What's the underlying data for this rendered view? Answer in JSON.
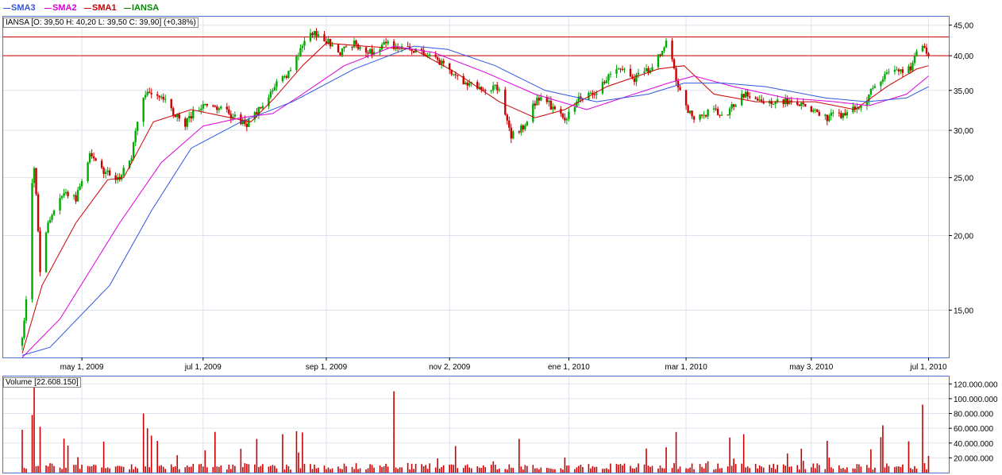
{
  "legend": [
    {
      "label": "SMA3",
      "color": "#3355dd"
    },
    {
      "label": "SMA2",
      "color": "#dd00dd"
    },
    {
      "label": "SMA1",
      "color": "#cc0000"
    },
    {
      "label": "IANSA",
      "color": "#008800"
    }
  ],
  "price_tag": "IANSA [O: 39,50  H: 40,20  L: 39,50  C: 39,90] (+0,38%)",
  "volume_tag": "Volume [22.608.150]",
  "chart_data": [
    {
      "type": "candlestick",
      "ticker": "IANSA",
      "y_scale": "log",
      "ylim": [
        12.5,
        46.5
      ],
      "yticks": [
        {
          "value": 45,
          "label": "45,00"
        },
        {
          "value": 40,
          "label": "40,00"
        },
        {
          "value": 35,
          "label": "35,00"
        },
        {
          "value": 30,
          "label": "30,00"
        },
        {
          "value": 25,
          "label": "25,00"
        },
        {
          "value": 20,
          "label": "20,00"
        },
        {
          "value": 15,
          "label": "15,00"
        }
      ],
      "xlim": [
        "2009-04-01",
        "2010-07-08"
      ],
      "xticks": [
        {
          "date": "2009-05-01",
          "label": "may 1, 2009"
        },
        {
          "date": "2009-07-01",
          "label": "jul 1, 2009"
        },
        {
          "date": "2009-09-01",
          "label": "sep 1, 2009"
        },
        {
          "date": "2009-11-02",
          "label": "nov 2, 2009"
        },
        {
          "date": "2010-01-01",
          "label": "ene 1, 2010"
        },
        {
          "date": "2010-03-01",
          "label": "mar 1, 2010"
        },
        {
          "date": "2010-05-03",
          "label": "may 3, 2010"
        },
        {
          "date": "2010-07-01",
          "label": "jul 1, 2010"
        }
      ],
      "horizontal_lines": [
        43.0,
        40.0
      ],
      "close_keypoints": [
        [
          "2009-04-01",
          13.5
        ],
        [
          "2009-04-03",
          15.5
        ],
        [
          "2009-04-06",
          24.5
        ],
        [
          "2009-04-07",
          26.0
        ],
        [
          "2009-04-10",
          17.5
        ],
        [
          "2009-04-14",
          21.0
        ],
        [
          "2009-04-21",
          23.5
        ],
        [
          "2009-04-28",
          23.0
        ],
        [
          "2009-05-05",
          27.5
        ],
        [
          "2009-05-12",
          25.5
        ],
        [
          "2009-05-20",
          25.0
        ],
        [
          "2009-05-26",
          27.0
        ],
        [
          "2009-05-31",
          34.0
        ],
        [
          "2009-06-03",
          35.0
        ],
        [
          "2009-06-14",
          33.0
        ],
        [
          "2009-06-21",
          30.5
        ],
        [
          "2009-06-28",
          32.5
        ],
        [
          "2009-07-05",
          33.0
        ],
        [
          "2009-07-14",
          32.0
        ],
        [
          "2009-07-23",
          30.5
        ],
        [
          "2009-07-30",
          33.0
        ],
        [
          "2009-08-06",
          35.5
        ],
        [
          "2009-08-14",
          37.5
        ],
        [
          "2009-08-19",
          41.5
        ],
        [
          "2009-08-25",
          43.5
        ],
        [
          "2009-09-01",
          42.5
        ],
        [
          "2009-09-08",
          40.5
        ],
        [
          "2009-09-15",
          42.0
        ],
        [
          "2009-09-24",
          40.5
        ],
        [
          "2009-09-30",
          42.0
        ],
        [
          "2009-10-10",
          41.0
        ],
        [
          "2009-10-20",
          40.5
        ],
        [
          "2009-10-30",
          38.5
        ],
        [
          "2009-11-08",
          36.5
        ],
        [
          "2009-11-18",
          35.0
        ],
        [
          "2009-11-27",
          35.5
        ],
        [
          "2009-11-30",
          31.5
        ],
        [
          "2009-12-03",
          29.5
        ],
        [
          "2009-12-10",
          30.5
        ],
        [
          "2009-12-16",
          34.0
        ],
        [
          "2009-12-23",
          33.0
        ],
        [
          "2009-12-30",
          31.0
        ],
        [
          "2010-01-06",
          34.0
        ],
        [
          "2010-01-15",
          35.0
        ],
        [
          "2010-01-27",
          38.5
        ],
        [
          "2010-02-02",
          36.5
        ],
        [
          "2010-02-10",
          38.0
        ],
        [
          "2010-02-17",
          40.5
        ],
        [
          "2010-02-20",
          43.0
        ],
        [
          "2010-02-24",
          36.5
        ],
        [
          "2010-02-28",
          33.5
        ],
        [
          "2010-03-05",
          31.0
        ],
        [
          "2010-03-14",
          32.5
        ],
        [
          "2010-03-21",
          32.0
        ],
        [
          "2010-03-30",
          34.5
        ],
        [
          "2010-04-08",
          33.5
        ],
        [
          "2010-04-20",
          33.5
        ],
        [
          "2010-04-30",
          33.0
        ],
        [
          "2010-05-10",
          31.5
        ],
        [
          "2010-05-20",
          32.0
        ],
        [
          "2010-05-29",
          33.0
        ],
        [
          "2010-06-06",
          36.5
        ],
        [
          "2010-06-14",
          38.0
        ],
        [
          "2010-06-22",
          38.0
        ],
        [
          "2010-06-26",
          41.5
        ],
        [
          "2010-06-30",
          40.5
        ],
        [
          "2010-07-01",
          39.9
        ]
      ],
      "overlays": [
        {
          "name": "SMA1",
          "color": "#cc0000",
          "points": [
            [
              "2009-04-01",
              12.7
            ],
            [
              "2009-04-11",
              16.5
            ],
            [
              "2009-04-28",
              21.0
            ],
            [
              "2009-05-14",
              24.8
            ],
            [
              "2009-05-22",
              25.0
            ],
            [
              "2009-06-06",
              31.0
            ],
            [
              "2009-06-25",
              32.5
            ],
            [
              "2009-07-25",
              31.0
            ],
            [
              "2009-08-06",
              34.0
            ],
            [
              "2009-08-20",
              38.5
            ],
            [
              "2009-09-01",
              42.0
            ],
            [
              "2009-09-20",
              41.5
            ],
            [
              "2009-10-15",
              41.0
            ],
            [
              "2009-11-05",
              37.5
            ],
            [
              "2009-11-27",
              33.5
            ],
            [
              "2009-12-15",
              31.5
            ],
            [
              "2009-12-30",
              32.5
            ],
            [
              "2010-01-20",
              35.5
            ],
            [
              "2010-02-15",
              38.0
            ],
            [
              "2010-02-28",
              38.5
            ],
            [
              "2010-03-15",
              34.5
            ],
            [
              "2010-04-05",
              33.5
            ],
            [
              "2010-05-05",
              33.5
            ],
            [
              "2010-05-25",
              32.5
            ],
            [
              "2010-06-10",
              35.5
            ],
            [
              "2010-06-25",
              38.0
            ],
            [
              "2010-07-01",
              38.5
            ]
          ]
        },
        {
          "name": "SMA2",
          "color": "#dd00dd",
          "points": [
            [
              "2009-04-01",
              12.5
            ],
            [
              "2009-04-20",
              14.5
            ],
            [
              "2009-05-20",
              21.0
            ],
            [
              "2009-06-10",
              26.5
            ],
            [
              "2009-07-01",
              30.5
            ],
            [
              "2009-07-20",
              31.5
            ],
            [
              "2009-08-05",
              32.0
            ],
            [
              "2009-08-20",
              34.5
            ],
            [
              "2009-09-10",
              38.5
            ],
            [
              "2009-10-05",
              41.5
            ],
            [
              "2009-10-25",
              40.5
            ],
            [
              "2009-11-20",
              37.5
            ],
            [
              "2009-12-15",
              34.5
            ],
            [
              "2010-01-10",
              32.5
            ],
            [
              "2010-01-28",
              34.0
            ],
            [
              "2010-02-20",
              36.0
            ],
            [
              "2010-03-05",
              37.0
            ],
            [
              "2010-03-25",
              35.5
            ],
            [
              "2010-04-20",
              34.0
            ],
            [
              "2010-05-15",
              33.5
            ],
            [
              "2010-06-01",
              33.0
            ],
            [
              "2010-06-20",
              34.5
            ],
            [
              "2010-07-01",
              37.0
            ]
          ]
        },
        {
          "name": "SMA3",
          "color": "#3355dd",
          "points": [
            [
              "2009-04-01",
              12.6
            ],
            [
              "2009-04-15",
              13.0
            ],
            [
              "2009-05-15",
              16.5
            ],
            [
              "2009-06-05",
              22.0
            ],
            [
              "2009-06-25",
              28.0
            ],
            [
              "2009-07-20",
              31.0
            ],
            [
              "2009-08-15",
              33.5
            ],
            [
              "2009-09-15",
              38.0
            ],
            [
              "2009-10-15",
              41.5
            ],
            [
              "2009-11-01",
              41.0
            ],
            [
              "2009-11-25",
              38.5
            ],
            [
              "2009-12-20",
              35.0
            ],
            [
              "2010-01-15",
              33.5
            ],
            [
              "2010-02-10",
              34.5
            ],
            [
              "2010-02-28",
              36.0
            ],
            [
              "2010-03-20",
              36.0
            ],
            [
              "2010-04-10",
              35.5
            ],
            [
              "2010-05-10",
              34.0
            ],
            [
              "2010-05-31",
              33.5
            ],
            [
              "2010-06-20",
              34.0
            ],
            [
              "2010-07-01",
              35.5
            ]
          ]
        }
      ]
    },
    {
      "type": "bar",
      "series": [
        {
          "name": "Volume",
          "color": "#cc0000"
        }
      ],
      "ylim": [
        0,
        130000000
      ],
      "yticks": [
        {
          "value": 20000000,
          "label": "20.000.000"
        },
        {
          "value": 40000000,
          "label": "40.000.000"
        },
        {
          "value": 60000000,
          "label": "60.000.000"
        },
        {
          "value": 80000000,
          "label": "80.000.000"
        },
        {
          "value": 100000000,
          "label": "100.000.000"
        },
        {
          "value": 120000000,
          "label": "120.000.000"
        }
      ],
      "spikes": [
        [
          "2009-04-01",
          58000000
        ],
        [
          "2009-04-06",
          78000000
        ],
        [
          "2009-04-07",
          128000000
        ],
        [
          "2009-04-10",
          62000000
        ],
        [
          "2009-04-22",
          46000000
        ],
        [
          "2009-05-12",
          42000000
        ],
        [
          "2009-06-01",
          80000000
        ],
        [
          "2009-06-03",
          60000000
        ],
        [
          "2009-06-05",
          50000000
        ],
        [
          "2009-08-10",
          52000000
        ],
        [
          "2009-08-17",
          56000000
        ],
        [
          "2009-10-04",
          107000000
        ],
        [
          "2009-10-05",
          110000000
        ],
        [
          "2010-02-24",
          55000000
        ],
        [
          "2010-03-28",
          48000000
        ],
        [
          "2010-03-30",
          52000000
        ],
        [
          "2010-06-08",
          64000000
        ],
        [
          "2010-06-28",
          92000000
        ],
        [
          "2010-07-01",
          22608150
        ]
      ]
    }
  ]
}
